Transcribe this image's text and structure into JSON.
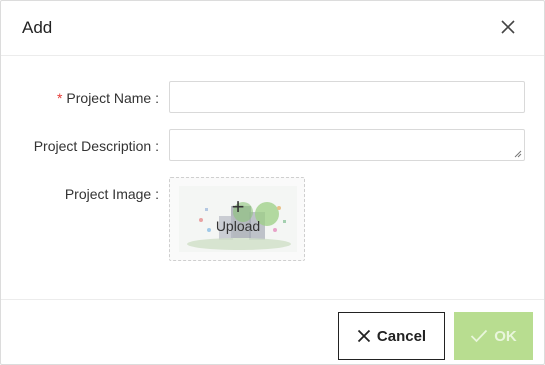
{
  "dialog": {
    "title": "Add"
  },
  "form": {
    "project_name": {
      "required_mark": "*",
      "label": "Project Name :",
      "value": "",
      "placeholder": ""
    },
    "project_description": {
      "label": "Project Description :",
      "value": "",
      "placeholder": ""
    },
    "project_image": {
      "label": "Project Image :",
      "upload_label": "Upload",
      "upload_icon": "plus-icon"
    }
  },
  "footer": {
    "cancel_label": "Cancel",
    "ok_label": "OK",
    "ok_color": "#b8dd90",
    "required_color": "#e53935"
  }
}
